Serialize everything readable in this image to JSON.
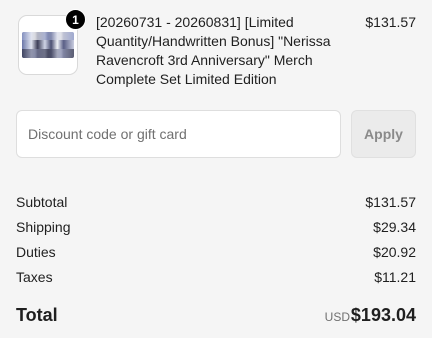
{
  "line_item": {
    "quantity": "1",
    "title": "[20260731 - 20260831] [Limited Quantity/Handwritten Bonus] \"Nerissa Ravencroft 3rd Anniversary\" Merch Complete Set Limited Edition",
    "price": "$131.57"
  },
  "discount": {
    "placeholder": "Discount code or gift card",
    "value": "",
    "apply_label": "Apply"
  },
  "summary": {
    "rows": [
      {
        "label": "Subtotal",
        "value": "$131.57"
      },
      {
        "label": "Shipping",
        "value": "$29.34"
      },
      {
        "label": "Duties",
        "value": "$20.92"
      },
      {
        "label": "Taxes",
        "value": "$11.21"
      }
    ],
    "total_label": "Total",
    "currency": "USD",
    "total_value": "$193.04"
  }
}
